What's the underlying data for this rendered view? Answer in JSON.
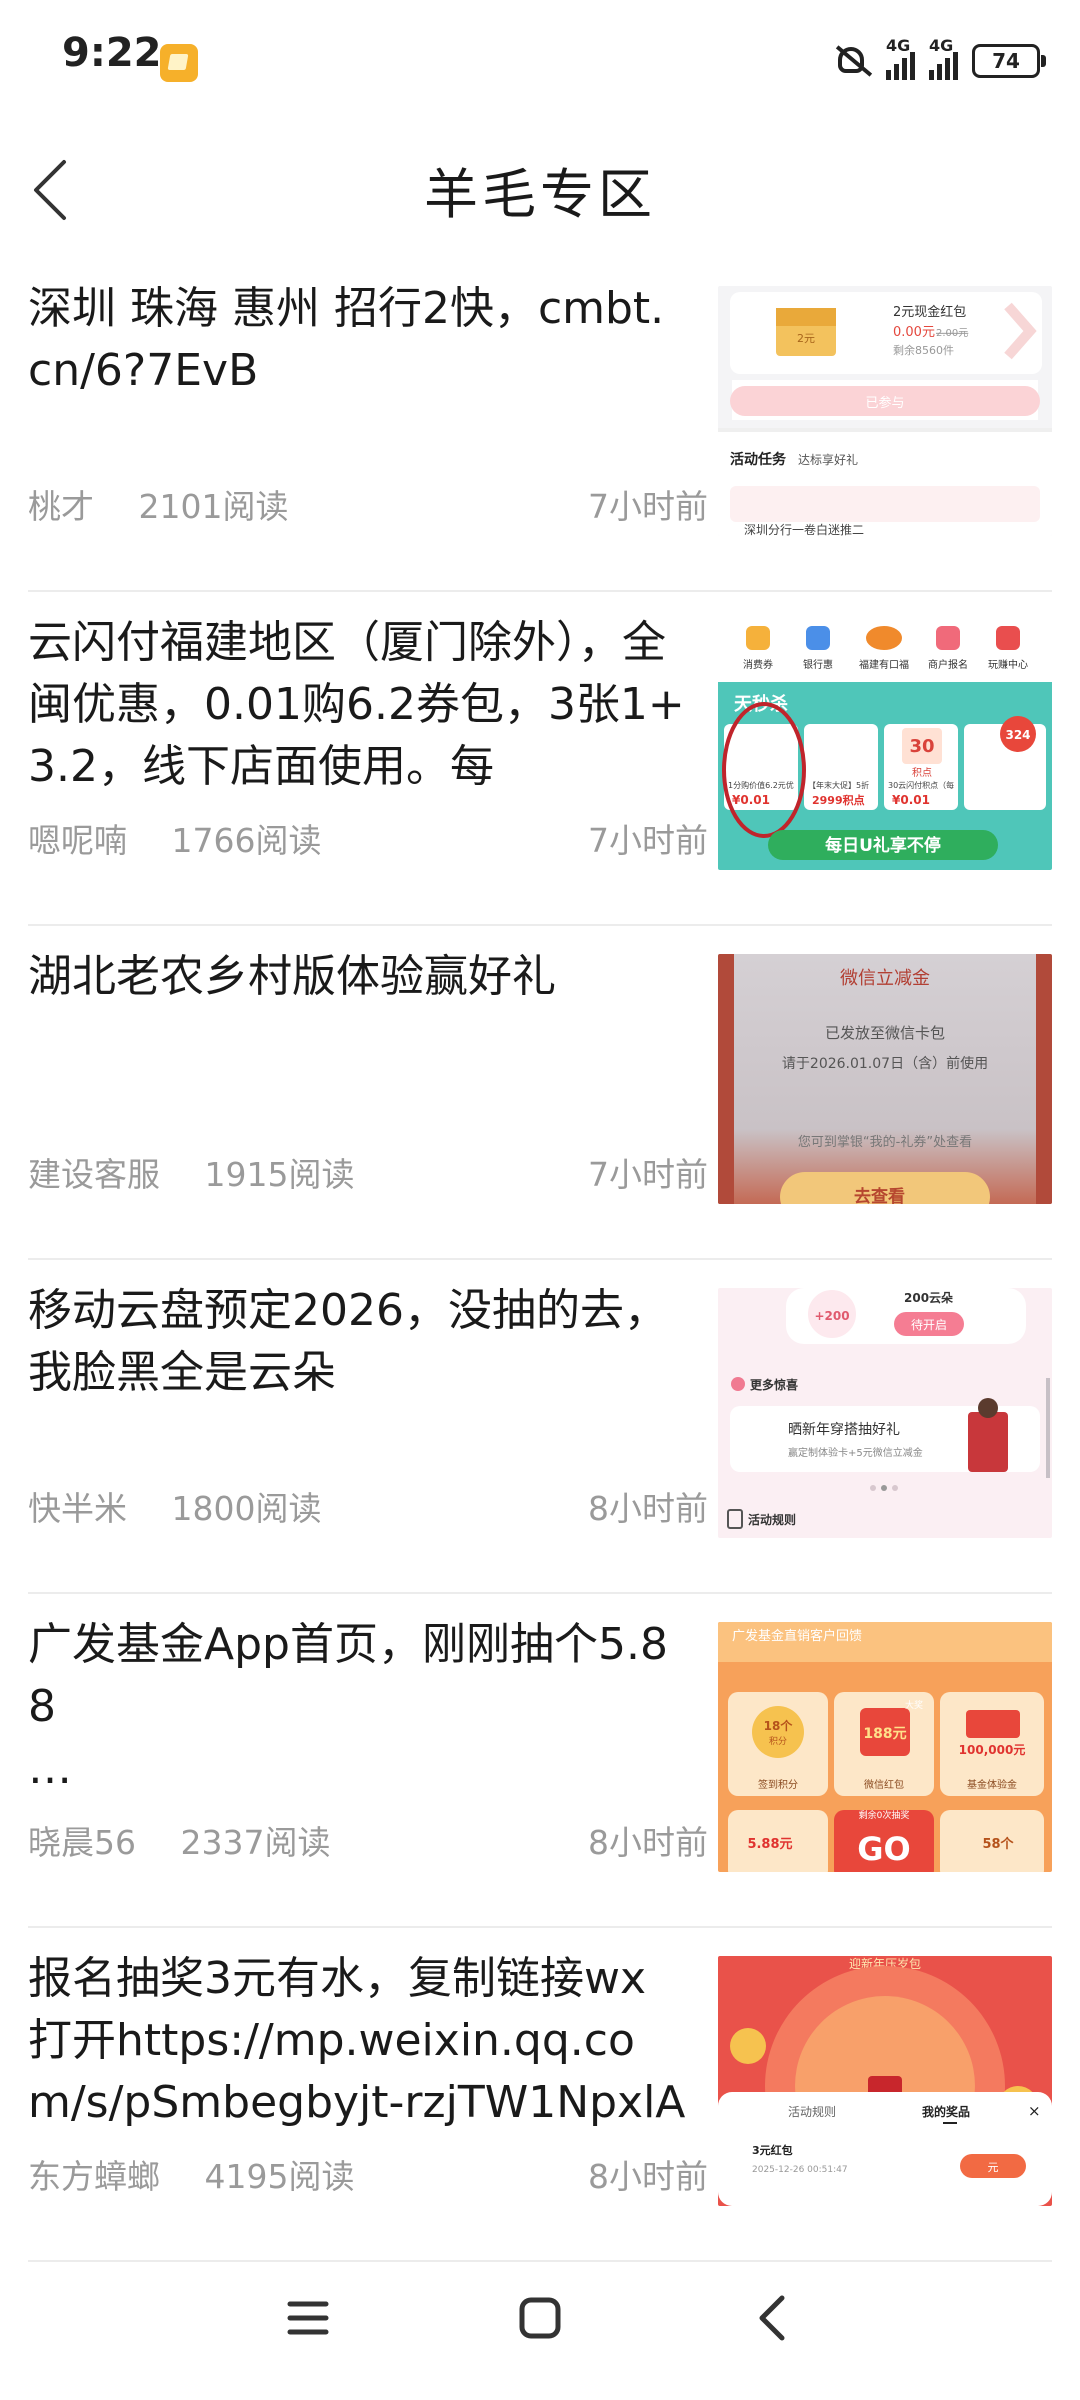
{
  "status_bar": {
    "time": "9:22",
    "network_1": "4G",
    "network_2": "4G",
    "battery": "74"
  },
  "header": {
    "title": "羊毛专区"
  },
  "items": [
    {
      "title": "深圳 珠海 惠州 招行2快，cmbt.cn/6?7EvB",
      "author": "桃才",
      "reads": "2101阅读",
      "time": "7小时前",
      "thumb": {
        "card_title": "2元现金红包",
        "price": "0.00元",
        "old_price": "2.00元",
        "stock": "剩余8560件",
        "button": "已参与",
        "section": "活动任务",
        "section_sub": "达标享好礼",
        "envelope_amount": "2元",
        "task_line": "深圳分行一卷白迷推二"
      }
    },
    {
      "title": "云闪付福建地区（厦门除外），全闽优惠，0.01购6.2券包，3张1+3.2，线下店面使用。每",
      "author": "嗯呢喃",
      "reads": "1766阅读",
      "time": "7小时前",
      "thumb": {
        "tabs": [
          "消费券",
          "银行惠",
          "福建有口福",
          "商户报名",
          "玩赚中心"
        ],
        "banner": "天秒杀",
        "cards": [
          {
            "label": "1分购价值6.2元优",
            "price": "¥0.01"
          },
          {
            "label": "【年末大促】5折",
            "price": "2999积点"
          },
          {
            "label": "30云闪付积点（每",
            "price": "¥0.01"
          }
        ],
        "badge_30": "30",
        "badge_30_label": "积点",
        "badge_324": "324",
        "footer": "每日U礼享不停"
      }
    },
    {
      "title": "湖北老农乡村版体验赢好礼",
      "author": "建设客服",
      "reads": "1915阅读",
      "time": "7小时前",
      "thumb": {
        "heading": "微信立减金",
        "line1": "已发放至微信卡包",
        "line2": "请于2026.01.07日（含）前使用",
        "line3": "您可到掌银“我的-礼券”处查看",
        "button": "去查看"
      }
    },
    {
      "title": "移动云盘预定2026，没抽的去，我脸黑全是云朵",
      "author": "快半米",
      "reads": "1800阅读",
      "time": "8小时前",
      "thumb": {
        "cloud_plus": "+200",
        "cloud_label": "200云朵",
        "open_btn": "待开启",
        "more": "更多惊喜",
        "promo": "晒新年穿搭抽好礼",
        "promo_sub": "赢定制体验卡+5元微信立减金",
        "rules": "活动规则"
      }
    },
    {
      "title": "广发基金App首页，刚刚抽个5.88\n…",
      "author": "晓晨56",
      "reads": "2337阅读",
      "time": "8小时前",
      "thumb": {
        "heading": "广发基金直销客户回馈",
        "prizes": [
          {
            "big": "18个",
            "sub": "积分",
            "label": "签到积分"
          },
          {
            "big": "188元",
            "sub": "大奖",
            "label": "微信红包"
          },
          {
            "big": "100,000元",
            "sub": "",
            "label": "基金体验金"
          }
        ],
        "bottom": [
          "5.88元",
          "GO",
          "58个"
        ],
        "remaining": "剩余0次抽奖"
      }
    },
    {
      "title": "报名抽奖3元有水，复制链接wx打开https://mp.weixin.qq.com/s/pSmbegbyjt-rzjTW1NpxlA",
      "author": "东方蟑螂",
      "reads": "4195阅读",
      "time": "8小时前",
      "thumb": {
        "top_text": "迎新年压岁包",
        "tab_rules": "活动规则",
        "tab_prizes": "我的奖品",
        "close": "×",
        "prize": "3元红包",
        "prize_time": "2025-12-26 00:51:47",
        "prize_btn": "元"
      }
    }
  ]
}
